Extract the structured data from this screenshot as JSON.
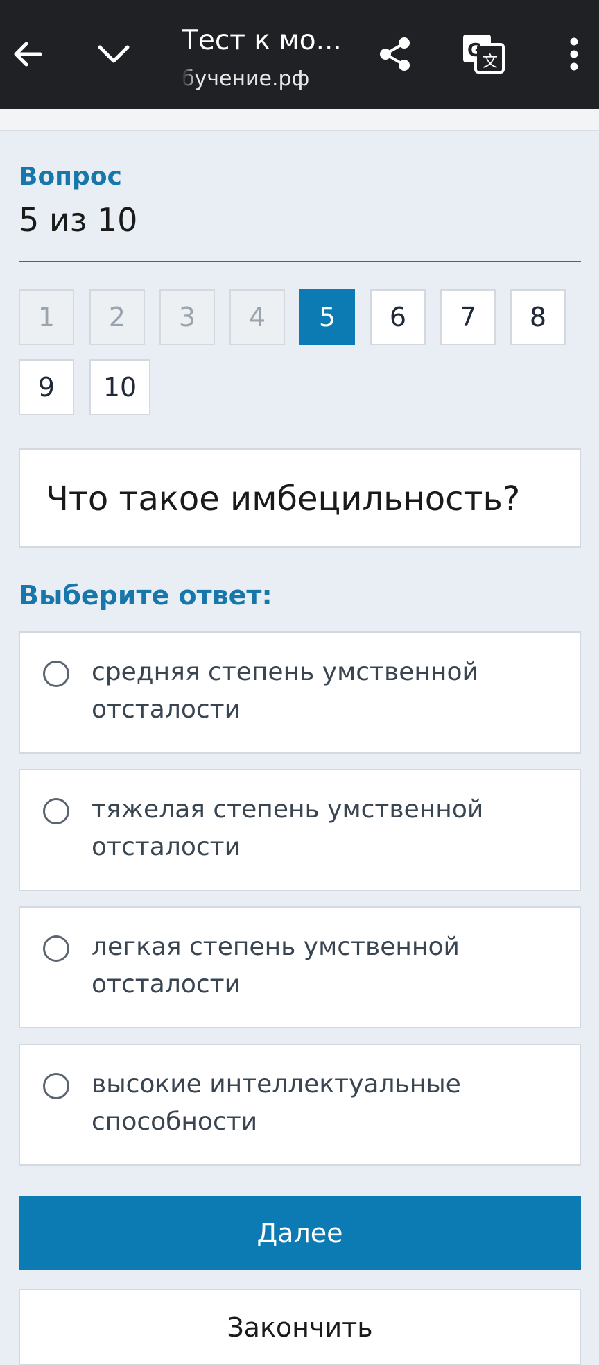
{
  "browser": {
    "title": "Тест к мо...",
    "url": "бучение.рф",
    "icons": [
      "back-arrow-icon",
      "chevron-down-icon",
      "share-icon",
      "translate-icon",
      "more-vert-icon"
    ]
  },
  "quiz": {
    "question_label": "Вопрос",
    "question_counter": "5 из 10",
    "nav": [
      "1",
      "2",
      "3",
      "4",
      "5",
      "6",
      "7",
      "8",
      "9",
      "10"
    ],
    "current": 5,
    "question_text": "Что такое имбецильность?",
    "choose_label": "Выберите ответ:",
    "answers": [
      "средняя степень умственной отсталости",
      "тяжелая степень умственной отсталости",
      "легкая степень умственной отсталости",
      "высокие интеллектуальные способности"
    ],
    "next_label": "Далее",
    "finish_label": "Закончить"
  },
  "colors": {
    "accent": "#0c7bb3",
    "label": "#1877aa",
    "background": "#e8eef4",
    "appbar": "#202124"
  }
}
